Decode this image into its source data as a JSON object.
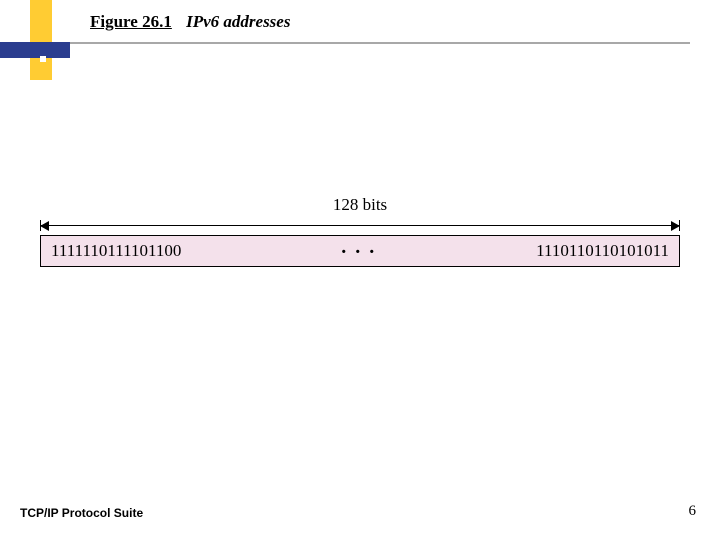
{
  "title": {
    "figure_label": "Figure 26.1",
    "caption": "IPv6 addresses"
  },
  "figure": {
    "span_label": "128 bits",
    "left_bits": "1111110111101100",
    "mid_dots": ". . .",
    "right_bits": "1110110110101011"
  },
  "footer": {
    "left": "TCP/IP Protocol Suite",
    "page": "6"
  }
}
